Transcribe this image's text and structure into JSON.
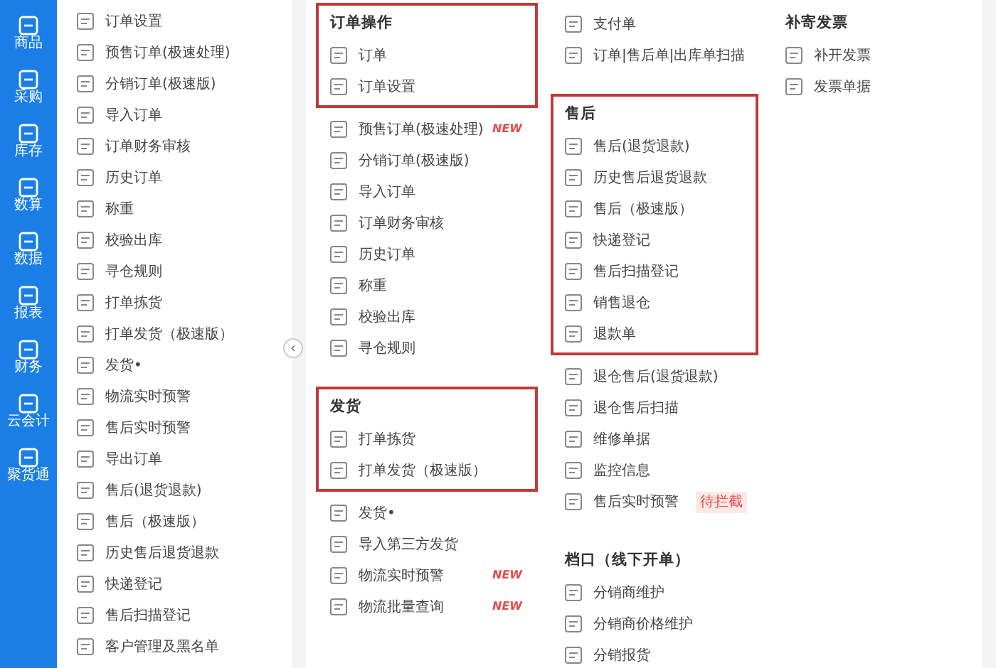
{
  "sidebar": [
    {
      "label": "商品"
    },
    {
      "label": "采购"
    },
    {
      "label": "库存"
    },
    {
      "label": "数算"
    },
    {
      "label": "数据"
    },
    {
      "label": "报表"
    },
    {
      "label": "财务"
    },
    {
      "label": "云会计"
    },
    {
      "label": "聚货通"
    }
  ],
  "quick_menu": [
    {
      "label": "订单设置"
    },
    {
      "label": "预售订单(极速处理)"
    },
    {
      "label": "分销订单(极速版)"
    },
    {
      "label": "导入订单"
    },
    {
      "label": "订单财务审核"
    },
    {
      "label": "历史订单"
    },
    {
      "label": "称重"
    },
    {
      "label": "校验出库"
    },
    {
      "label": "寻仓规则"
    },
    {
      "label": "打单拣货"
    },
    {
      "label": "打单发货（极速版）"
    },
    {
      "label": "发货•"
    },
    {
      "label": "物流实时预警"
    },
    {
      "label": "售后实时预警"
    },
    {
      "label": "导出订单"
    },
    {
      "label": "售后(退货退款)"
    },
    {
      "label": "售后（极速版）"
    },
    {
      "label": "历史售后退货退款"
    },
    {
      "label": "快递登记"
    },
    {
      "label": "售后扫描登记"
    },
    {
      "label": "客户管理及黑名单"
    }
  ],
  "collapse_button": "‹",
  "columns": [
    {
      "sections": [
        {
          "title": "订单操作",
          "highlighted": true,
          "items": [
            {
              "label": "订单"
            },
            {
              "label": "订单设置"
            }
          ]
        },
        {
          "highlighted": false,
          "items": [
            {
              "label": "预售订单(极速处理)",
              "badge": "NEW"
            },
            {
              "label": "分销订单(极速版)"
            },
            {
              "label": "导入订单"
            },
            {
              "label": "订单财务审核"
            },
            {
              "label": "历史订单"
            },
            {
              "label": "称重"
            },
            {
              "label": "校验出库"
            },
            {
              "label": "寻仓规则"
            }
          ]
        },
        {
          "title": "发货",
          "highlighted": true,
          "items": [
            {
              "label": "打单拣货"
            },
            {
              "label": "打单发货（极速版）"
            }
          ]
        },
        {
          "highlighted": false,
          "items": [
            {
              "label": "发货•"
            },
            {
              "label": "导入第三方发货"
            },
            {
              "label": "物流实时预警",
              "badge": "NEW"
            },
            {
              "label": "物流批量查询",
              "badge": "NEW"
            }
          ]
        }
      ]
    },
    {
      "sections": [
        {
          "highlighted": false,
          "items": [
            {
              "label": "支付单"
            },
            {
              "label": "订单|售后单|出库单扫描"
            }
          ]
        },
        {
          "title": "售后",
          "highlighted": true,
          "items": [
            {
              "label": "售后(退货退款)"
            },
            {
              "label": "历史售后退货退款"
            },
            {
              "label": "售后（极速版）"
            },
            {
              "label": "快递登记"
            },
            {
              "label": "售后扫描登记"
            },
            {
              "label": "销售退仓"
            },
            {
              "label": "退款单"
            }
          ]
        },
        {
          "highlighted": false,
          "items": [
            {
              "label": "退仓售后(退货退款)"
            },
            {
              "label": "退仓售后扫描"
            },
            {
              "label": "维修单据"
            },
            {
              "label": "监控信息"
            },
            {
              "label": "售后实时预警",
              "badge": "待拦截"
            }
          ]
        },
        {
          "title": "档口（线下开单）",
          "highlighted": false,
          "items": [
            {
              "label": "分销商维护"
            },
            {
              "label": "分销商价格维护"
            },
            {
              "label": "分销报货"
            }
          ]
        }
      ]
    },
    {
      "sections": [
        {
          "title": "补寄发票",
          "highlighted": false,
          "items": [
            {
              "label": "补开发票"
            },
            {
              "label": "发票单据"
            }
          ]
        }
      ]
    }
  ]
}
